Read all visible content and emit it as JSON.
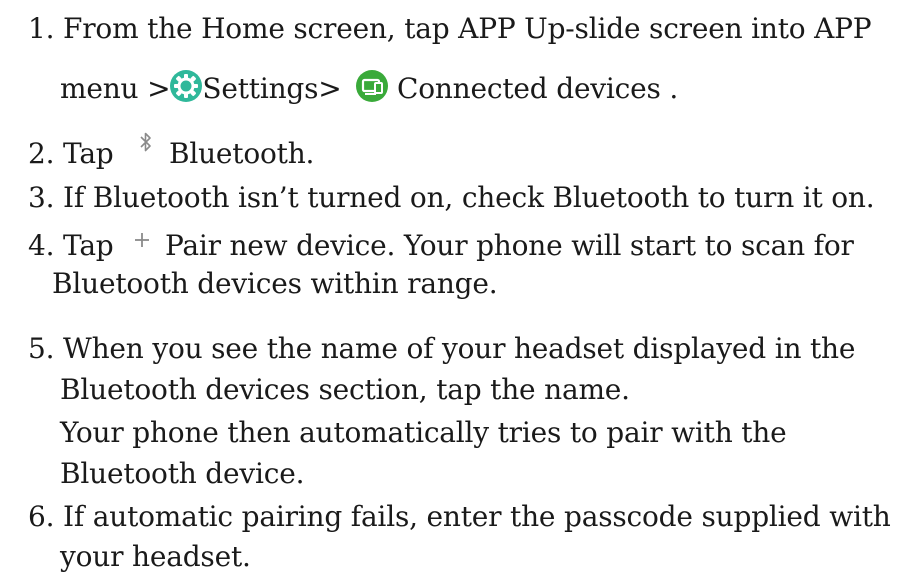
{
  "steps": {
    "s1_a": "1. From the Home screen, tap APP  Up-slide screen into APP",
    "s1_b_prefix": "menu  >",
    "s1_b_settings": "Settings>",
    "s1_b_connected": "Connected devices .",
    "s2_prefix": "2. Tap",
    "s2_suffix": "Bluetooth.",
    "s3": "3. If Bluetooth isn’t turned on, check Bluetooth to turn it on.",
    "s4_prefix": "4. Tap",
    "s4_suffix": "Pair new device. Your phone will start to scan for",
    "s4_b": "Bluetooth devices within range.",
    "s5_a": "5. When you see the name of your headset displayed in the",
    "s5_b": "Bluetooth devices section, tap the name.",
    "s5_c": "Your phone then automatically tries to pair with the",
    "s5_d": "Bluetooth device.",
    "s6_a": "6. If automatic pairing fails, enter the passcode supplied with",
    "s6_b": "your headset."
  },
  "icons": {
    "settings": "gear-icon",
    "connected_devices": "connected-devices-icon",
    "bluetooth": "bluetooth-icon",
    "add": "plus-icon"
  },
  "colors": {
    "settings_icon": "#2fb89a",
    "connected_devices_icon": "#3aaa3a",
    "glyph_gray": "#8a8a8a"
  }
}
